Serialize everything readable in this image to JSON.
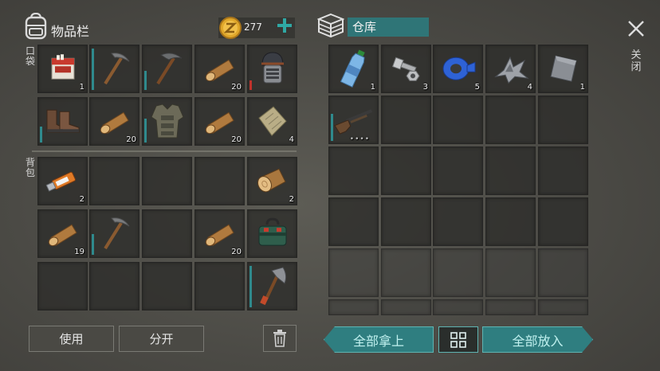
{
  "inventory": {
    "title": "物品栏",
    "coins": "277",
    "pocket_label": "口袋",
    "backpack_label": "背包"
  },
  "storage": {
    "title": "仓库"
  },
  "close_label": "关闭",
  "buttons": {
    "use": "使用",
    "split": "分开",
    "take_all": "全部拿上",
    "put_all": "全部放入"
  },
  "pocket_items": [
    {
      "name": "cigarettes-icon",
      "count": "1"
    },
    {
      "name": "pickaxe-icon",
      "count": "",
      "durability": 0.9
    },
    {
      "name": "pickaxe-icon",
      "count": "",
      "durability": 0.4
    },
    {
      "name": "wood-log-icon",
      "count": "20"
    },
    {
      "name": "helmet-icon",
      "count": "",
      "durability": 0.2,
      "durability_color": "#c0322b"
    },
    {
      "name": "boots-icon",
      "count": "",
      "durability": 0.35
    },
    {
      "name": "wood-log-icon",
      "count": "20"
    },
    {
      "name": "armor-vest-icon",
      "count": "",
      "durability": 0.5
    },
    {
      "name": "wood-log-icon",
      "count": "20"
    },
    {
      "name": "cloth-icon",
      "count": "4"
    }
  ],
  "backpack_items": [
    {
      "name": "flash-drive-icon",
      "count": "2"
    },
    {
      "name": "empty",
      "count": ""
    },
    {
      "name": "empty",
      "count": ""
    },
    {
      "name": "empty",
      "count": ""
    },
    {
      "name": "wood-stump-icon",
      "count": "2"
    },
    {
      "name": "wood-log-icon",
      "count": "19"
    },
    {
      "name": "pickaxe-icon",
      "count": "",
      "durability": 0.45
    },
    {
      "name": "empty",
      "count": ""
    },
    {
      "name": "wood-log-icon",
      "count": "20"
    },
    {
      "name": "medkit-bag-icon",
      "count": ""
    },
    {
      "name": "empty",
      "count": ""
    },
    {
      "name": "empty",
      "count": ""
    },
    {
      "name": "empty",
      "count": ""
    },
    {
      "name": "empty",
      "count": ""
    },
    {
      "name": "hatchet-icon",
      "count": "",
      "durability": 0.9
    }
  ],
  "storage_items": [
    {
      "name": "water-bottle-icon",
      "count": "1"
    },
    {
      "name": "bolt-nut-icon",
      "count": "3"
    },
    {
      "name": "duct-tape-icon",
      "count": "5"
    },
    {
      "name": "scrap-metal-icon",
      "count": "4"
    },
    {
      "name": "metal-plate-icon",
      "count": "1"
    },
    {
      "name": "shotgun-icon",
      "count": "",
      "durability": 0.6,
      "ammo": "••••"
    }
  ],
  "colors": {
    "accent": "#2f7e80",
    "coin": "#e0a72a",
    "durability": "#2f8a8d",
    "durability_low": "#c0322b"
  }
}
